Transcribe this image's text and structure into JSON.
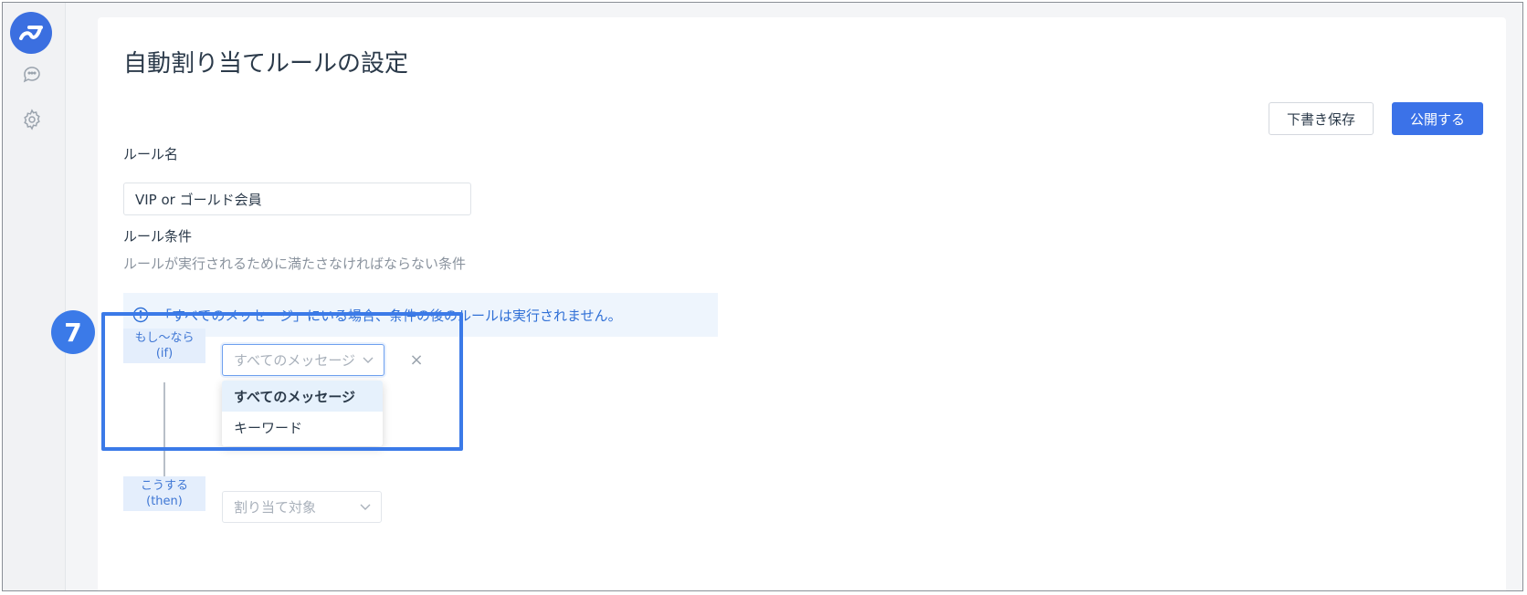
{
  "page": {
    "title": "自動割り当てルールの設定"
  },
  "toolbar": {
    "draft_label": "下書き保存",
    "publish_label": "公開する"
  },
  "rule_name": {
    "label": "ルール名",
    "value": "VIP or ゴールド会員"
  },
  "conditions": {
    "label": "ルール条件",
    "hint": "ルールが実行されるために満たさなければならない条件",
    "info": "「すべてのメッセージ」にいる場合、条件の後のルールは実行されません。",
    "if_tag_line1": "もし〜なら",
    "if_tag_line2": "(if)",
    "if_select_value": "すべてのメッセージ",
    "remove_symbol": "×",
    "options": [
      "すべてのメッセージ",
      "キーワード"
    ],
    "then_tag_line1": "こうする",
    "then_tag_line2": "(then)",
    "then_select_placeholder": "割り当て対象"
  },
  "annotation": {
    "step_number": "7"
  },
  "colors": {
    "accent": "#3b72e8",
    "highlight": "#3b7ae8",
    "info_bg": "#eef5fd",
    "tag_bg": "#e4eefc"
  },
  "icons": {
    "logo": "app-logo",
    "chat": "chat-bubbles-icon",
    "settings": "gear-icon",
    "info": "info-circle-icon",
    "chevron": "chevron-down-icon"
  }
}
